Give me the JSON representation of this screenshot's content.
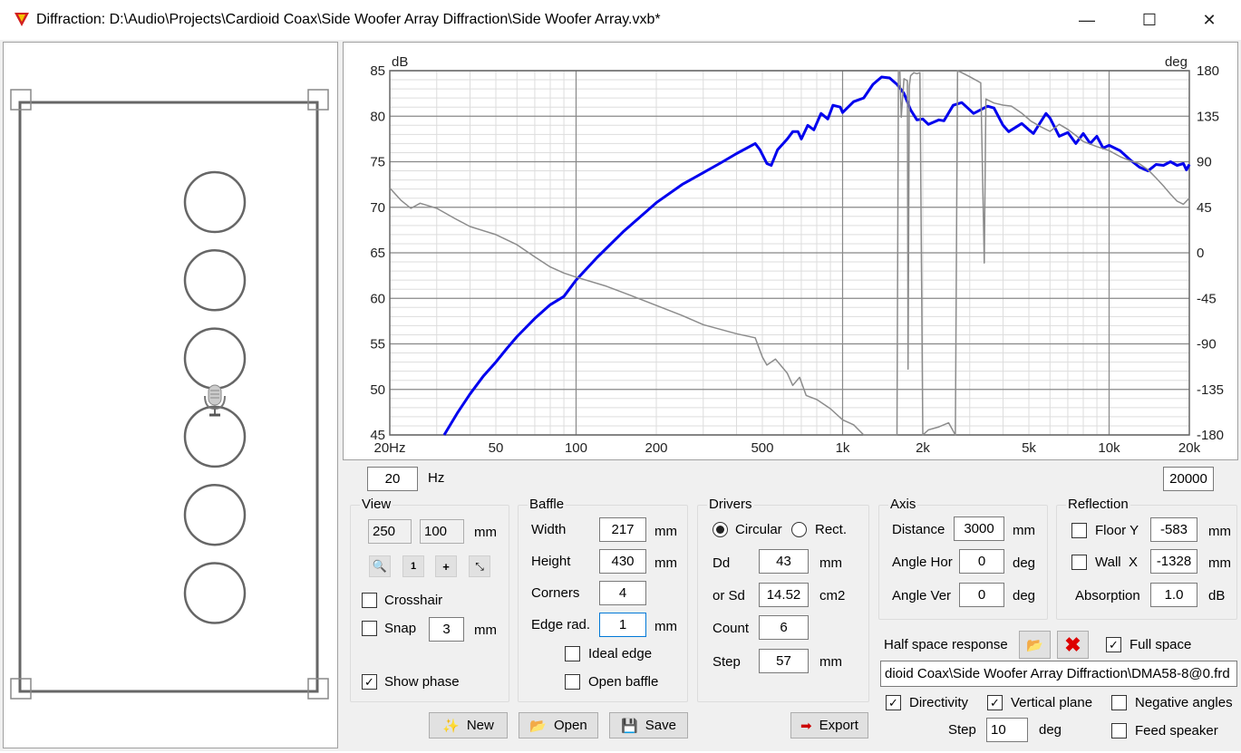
{
  "window": {
    "title": "Diffraction: D:\\Audio\\Projects\\Cardioid Coax\\Side Woofer Array Diffraction\\Side Woofer Array.vxb*",
    "minimize": "—",
    "maximize": "☐",
    "close": "✕"
  },
  "baffle_view": {
    "driver_count": 6,
    "microphone": "microphone-icon"
  },
  "chart_data": {
    "type": "line",
    "title": "",
    "xlabel": "Hz",
    "ylabel_left": "dB",
    "ylabel_right": "deg",
    "x_scale": "log",
    "xlim": [
      20,
      20000
    ],
    "ylim_left": [
      45,
      85
    ],
    "ylim_right": [
      -180,
      180
    ],
    "x_ticks": [
      {
        "v": 20,
        "l": "20Hz"
      },
      {
        "v": 50,
        "l": "50"
      },
      {
        "v": 100,
        "l": "100"
      },
      {
        "v": 200,
        "l": "200"
      },
      {
        "v": 500,
        "l": "500"
      },
      {
        "v": 1000,
        "l": "1k"
      },
      {
        "v": 2000,
        "l": "2k"
      },
      {
        "v": 5000,
        "l": "5k"
      },
      {
        "v": 10000,
        "l": "10k"
      },
      {
        "v": 20000,
        "l": "20k"
      }
    ],
    "y_ticks_left": [
      "85",
      "80",
      "75",
      "70",
      "65",
      "60",
      "55",
      "50",
      "45"
    ],
    "y_ticks_right": [
      "180",
      "135",
      "90",
      "45",
      "0",
      "-45",
      "-90",
      "-135",
      "-180"
    ],
    "grid": true,
    "series": [
      {
        "name": "SPL",
        "axis": "left",
        "color": "#0000ee",
        "points": [
          [
            32,
            45
          ],
          [
            36,
            47.5
          ],
          [
            40,
            49.5
          ],
          [
            45,
            51.5
          ],
          [
            50,
            53
          ],
          [
            55,
            54.5
          ],
          [
            60,
            55.8
          ],
          [
            70,
            57.8
          ],
          [
            80,
            59.3
          ],
          [
            90,
            60.2
          ],
          [
            100,
            62
          ],
          [
            120,
            64.5
          ],
          [
            150,
            67.3
          ],
          [
            200,
            70.5
          ],
          [
            250,
            72.5
          ],
          [
            300,
            73.8
          ],
          [
            350,
            74.9
          ],
          [
            400,
            75.9
          ],
          [
            470,
            77
          ],
          [
            490,
            76.3
          ],
          [
            520,
            74.8
          ],
          [
            540,
            74.6
          ],
          [
            570,
            76.3
          ],
          [
            620,
            77.5
          ],
          [
            650,
            78.3
          ],
          [
            680,
            78.3
          ],
          [
            700,
            77.5
          ],
          [
            740,
            79
          ],
          [
            780,
            78.5
          ],
          [
            830,
            80.3
          ],
          [
            880,
            79.7
          ],
          [
            920,
            81.2
          ],
          [
            980,
            81
          ],
          [
            1000,
            80.4
          ],
          [
            1100,
            81.6
          ],
          [
            1200,
            82
          ],
          [
            1300,
            83.5
          ],
          [
            1400,
            84.3
          ],
          [
            1500,
            84.2
          ],
          [
            1600,
            83.5
          ],
          [
            1700,
            82.5
          ],
          [
            1800,
            80.7
          ],
          [
            1900,
            79.6
          ],
          [
            2000,
            79.7
          ],
          [
            2100,
            79.1
          ],
          [
            2300,
            79.6
          ],
          [
            2400,
            79.5
          ],
          [
            2600,
            81.2
          ],
          [
            2800,
            81.5
          ],
          [
            3100,
            80.3
          ],
          [
            3500,
            81.1
          ],
          [
            3700,
            80.9
          ],
          [
            4000,
            79
          ],
          [
            4200,
            78.3
          ],
          [
            4700,
            79.2
          ],
          [
            5000,
            78.5
          ],
          [
            5200,
            78.1
          ],
          [
            5800,
            80.3
          ],
          [
            6000,
            79.8
          ],
          [
            6500,
            77.8
          ],
          [
            7000,
            78.2
          ],
          [
            7500,
            77
          ],
          [
            8000,
            78.1
          ],
          [
            8500,
            77
          ],
          [
            9000,
            77.8
          ],
          [
            9500,
            76.5
          ],
          [
            10000,
            76.8
          ],
          [
            11000,
            76.2
          ],
          [
            12000,
            75.2
          ],
          [
            13000,
            74.4
          ],
          [
            14000,
            74
          ],
          [
            15000,
            74.7
          ],
          [
            16000,
            74.6
          ],
          [
            17000,
            75
          ],
          [
            18000,
            74.6
          ],
          [
            19000,
            74.8
          ],
          [
            19500,
            74.1
          ],
          [
            20000,
            74.7
          ]
        ]
      },
      {
        "name": "Phase",
        "axis": "right",
        "color": "#8c8c8c",
        "points": [
          [
            20,
            64
          ],
          [
            22,
            52
          ],
          [
            24,
            44
          ],
          [
            26,
            49
          ],
          [
            30,
            44
          ],
          [
            35,
            34
          ],
          [
            40,
            26
          ],
          [
            50,
            18
          ],
          [
            60,
            8
          ],
          [
            70,
            -4
          ],
          [
            80,
            -14
          ],
          [
            90,
            -20
          ],
          [
            100,
            -24
          ],
          [
            130,
            -33
          ],
          [
            160,
            -42
          ],
          [
            200,
            -52
          ],
          [
            250,
            -62
          ],
          [
            300,
            -71
          ],
          [
            400,
            -80
          ],
          [
            470,
            -84
          ],
          [
            500,
            -103
          ],
          [
            520,
            -111
          ],
          [
            560,
            -105
          ],
          [
            620,
            -119
          ],
          [
            650,
            -131
          ],
          [
            690,
            -123
          ],
          [
            730,
            -141
          ],
          [
            800,
            -145
          ],
          [
            900,
            -154
          ],
          [
            1000,
            -165
          ],
          [
            1100,
            -170
          ],
          [
            1200,
            -180
          ],
          [
            1600,
            -180
          ],
          [
            1620,
            180
          ],
          [
            1640,
            180
          ],
          [
            1660,
            134
          ],
          [
            1700,
            172
          ],
          [
            1750,
            170
          ],
          [
            1760,
            -115
          ],
          [
            1780,
            165
          ],
          [
            1800,
            175
          ],
          [
            1850,
            178
          ],
          [
            1900,
            177
          ],
          [
            1950,
            178
          ],
          [
            2000,
            -180
          ],
          [
            2100,
            -175
          ],
          [
            2300,
            -172
          ],
          [
            2500,
            -168
          ],
          [
            2650,
            -180
          ],
          [
            2700,
            180
          ],
          [
            2800,
            178
          ],
          [
            3000,
            174
          ],
          [
            3300,
            168
          ],
          [
            3400,
            -10
          ],
          [
            3450,
            152
          ],
          [
            3700,
            148
          ],
          [
            4000,
            146
          ],
          [
            4300,
            145
          ],
          [
            4700,
            138
          ],
          [
            5100,
            130
          ],
          [
            5500,
            125
          ],
          [
            6000,
            120
          ],
          [
            6500,
            127
          ],
          [
            7000,
            122
          ],
          [
            7500,
            116
          ],
          [
            8000,
            110
          ],
          [
            9000,
            105
          ],
          [
            10000,
            101
          ],
          [
            11000,
            95
          ],
          [
            12000,
            91
          ],
          [
            13000,
            88
          ],
          [
            14000,
            82
          ],
          [
            15000,
            74
          ],
          [
            16000,
            66
          ],
          [
            17000,
            58
          ],
          [
            18000,
            51
          ],
          [
            19000,
            48
          ],
          [
            20000,
            54
          ]
        ]
      }
    ]
  },
  "freq_range": {
    "min_value": "20",
    "min_unit": "Hz",
    "max_value": "20000"
  },
  "view": {
    "title": "View",
    "x_value": "250",
    "y_value": "100",
    "unit": "mm",
    "zoom_out": "zoom-out-icon",
    "zoom_reset": "zoom-1-icon",
    "zoom_in": "zoom-in-icon",
    "fit": "fit-icon",
    "crosshair_label": "Crosshair",
    "crosshair_checked": false,
    "snap_label": "Snap",
    "snap_checked": false,
    "snap_value": "3",
    "snap_unit": "mm",
    "show_phase_label": "Show phase",
    "show_phase_checked": true
  },
  "baffle": {
    "title": "Baffle",
    "width_label": "Width",
    "width_value": "217",
    "width_unit": "mm",
    "height_label": "Height",
    "height_value": "430",
    "height_unit": "mm",
    "corners_label": "Corners",
    "corners_value": "4",
    "edge_label": "Edge rad.",
    "edge_value": "1",
    "edge_unit": "mm",
    "ideal_edge_label": "Ideal edge",
    "ideal_edge_checked": false,
    "open_baffle_label": "Open baffle",
    "open_baffle_checked": false
  },
  "drivers": {
    "title": "Drivers",
    "circular_label": "Circular",
    "circular_selected": true,
    "rect_label": "Rect.",
    "dd_label": "Dd",
    "dd_value": "43",
    "dd_unit": "mm",
    "sd_label": "or Sd",
    "sd_value": "14.52",
    "sd_unit": "cm2",
    "count_label": "Count",
    "count_value": "6",
    "step_label": "Step",
    "step_value": "57",
    "step_unit": "mm"
  },
  "axis": {
    "title": "Axis",
    "distance_label": "Distance",
    "distance_value": "3000",
    "distance_unit": "mm",
    "hor_label": "Angle Hor",
    "hor_value": "0",
    "hor_unit": "deg",
    "ver_label": "Angle Ver",
    "ver_value": "0",
    "ver_unit": "deg"
  },
  "reflection": {
    "title": "Reflection",
    "floor_label": "Floor Y",
    "floor_checked": false,
    "floor_value": "-583",
    "floor_unit": "mm",
    "wall_label": "Wall  X",
    "wall_checked": false,
    "wall_value": "-1328",
    "wall_unit": "mm",
    "absorption_label": "Absorption",
    "absorption_value": "1.0",
    "absorption_unit": "dB"
  },
  "half_space": {
    "label": "Half space response",
    "full_space_label": "Full space",
    "full_space_checked": true,
    "file_path": "dioid Coax\\Side Woofer Array Diffraction\\DMA58-8@0.frd",
    "directivity_label": "Directivity",
    "directivity_checked": true,
    "vertical_label": "Vertical plane",
    "vertical_checked": true,
    "negative_label": "Negative angles",
    "negative_checked": false,
    "step_label": "Step",
    "step_value": "10",
    "step_unit": "deg",
    "feed_label": "Feed speaker",
    "feed_checked": false
  },
  "buttons": {
    "new": "New",
    "open": "Open",
    "save": "Save",
    "export": "Export"
  }
}
